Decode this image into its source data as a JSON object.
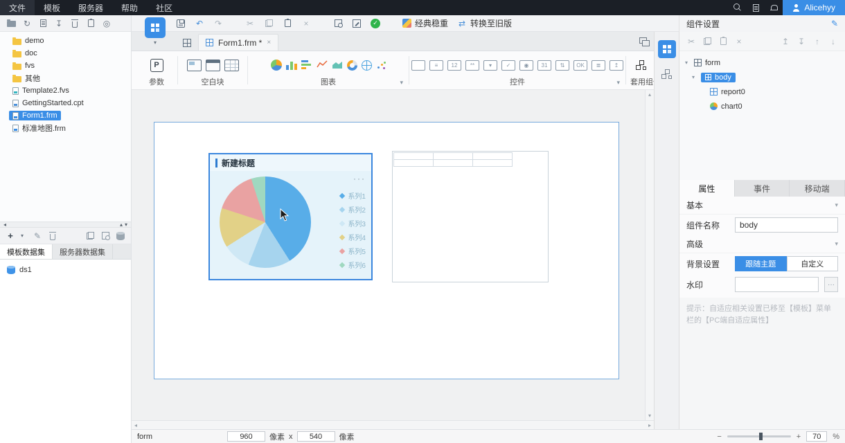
{
  "menubar": {
    "items": [
      "文件",
      "模板",
      "服务器",
      "帮助",
      "社区"
    ],
    "user_name": "Alicehyy"
  },
  "toolbar": {
    "theme_label": "经典稳重",
    "convert_label": "转换至旧版"
  },
  "file_panel": {
    "items": [
      {
        "name": "demo",
        "type": "folder"
      },
      {
        "name": "doc",
        "type": "folder"
      },
      {
        "name": "fvs",
        "type": "folder"
      },
      {
        "name": "其他",
        "type": "folder"
      },
      {
        "name": "Template2.fvs",
        "type": "fvs"
      },
      {
        "name": "GettingStarted.cpt",
        "type": "cpt"
      },
      {
        "name": "Form1.frm",
        "type": "frm",
        "selected": true
      },
      {
        "name": "标准地图.frm",
        "type": "frm"
      }
    ]
  },
  "dataset_panel": {
    "tabs": [
      {
        "label": "模板数据集",
        "active": true
      },
      {
        "label": "服务器数据集",
        "active": false
      }
    ],
    "items": [
      {
        "name": "ds1"
      }
    ]
  },
  "tabbar": {
    "active_tab": "Form1.frm *"
  },
  "ribbon": {
    "param_label": "参数",
    "blank_label": "空白块",
    "chart_label": "图表",
    "widget_label": "控件",
    "reuse_label": "套用组件"
  },
  "canvas": {
    "chart_block": {
      "title": "新建标题",
      "legend": [
        "系列1",
        "系列2",
        "系列3",
        "系列4",
        "系列5",
        "系列6"
      ],
      "pie": {
        "type": "pie",
        "values": [
          41,
          15,
          10,
          14,
          15,
          5
        ],
        "colors": [
          "#58ade8",
          "#a6d4ee",
          "#cfe8f5",
          "#e2d187",
          "#e9a2a2",
          "#9fd8c0"
        ]
      }
    }
  },
  "right_panel": {
    "title": "组件设置",
    "tree": {
      "root_label": "form",
      "body_label": "body",
      "child_report": "report0",
      "child_chart": "chart0"
    },
    "tabs": [
      "属性",
      "事件",
      "移动端"
    ],
    "basic_section": "基本",
    "advanced_section": "高级",
    "component_name_label": "组件名称",
    "component_name_value": "body",
    "background_label": "背景设置",
    "background_options": [
      "跟随主题",
      "自定义"
    ],
    "watermark_label": "水印",
    "hint": "提示：自适应相关设置已移至【模板】菜单栏的【PC端自适应属性】"
  },
  "statusbar": {
    "mode": "form",
    "page_width": "960",
    "px_label_1": "像素",
    "multiply": "x",
    "page_height": "540",
    "px_label_2": "像素",
    "zoom": "70",
    "percent": "%"
  },
  "icons": {
    "param": "P",
    "undo": "↶",
    "redo": "↷",
    "cut": "✂",
    "close_x": "×",
    "check": "✓",
    "swap": "⇄",
    "refresh": "↻",
    "locate": "◎",
    "plus": "+",
    "minus": "−",
    "pencil": "✎",
    "caret_down": "▾",
    "caret_up": "▴",
    "caret_left": "◂",
    "caret_right": "▸",
    "arrow_up": "↑",
    "arrow_down": "↓",
    "move_top": "↥",
    "move_bottom": "↧",
    "more": "···"
  }
}
